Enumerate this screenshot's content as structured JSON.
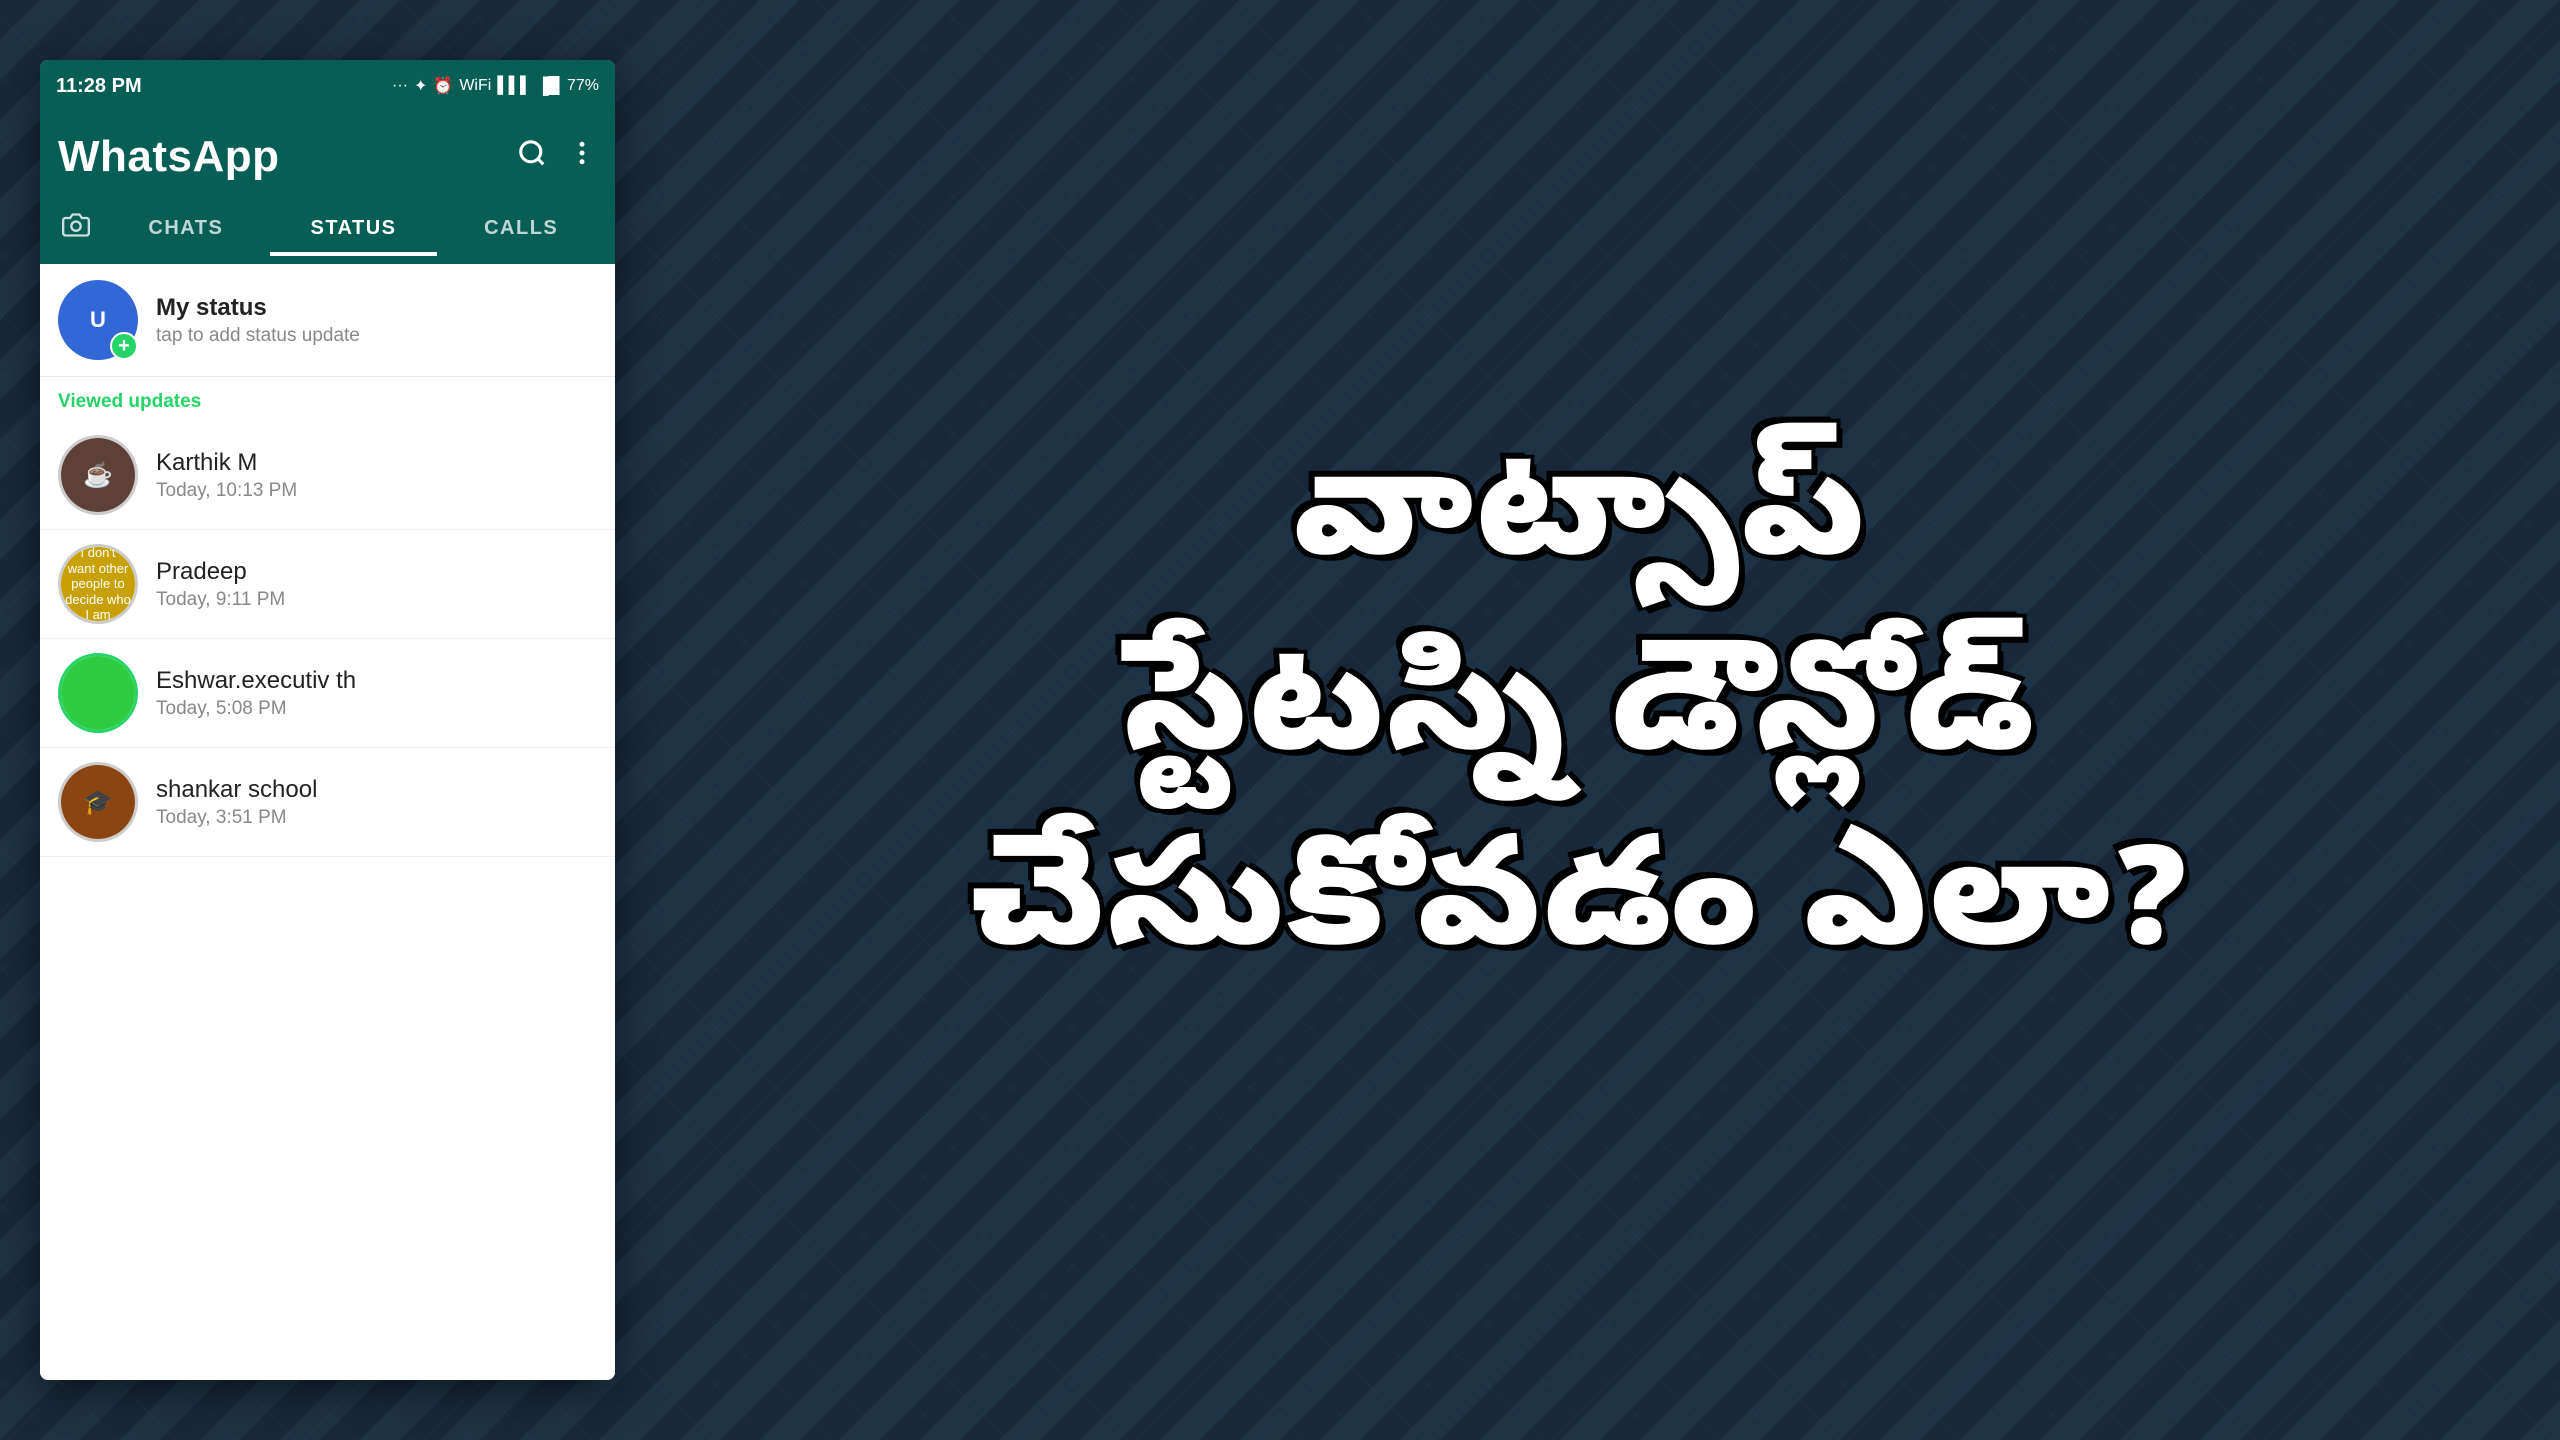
{
  "background": {
    "color": "#1c2d3e"
  },
  "status_bar": {
    "time": "11:28 PM",
    "battery": "77%",
    "icons": "... ⌛ ⏰ ☁ ▌▌▌ 🔋"
  },
  "header": {
    "title": "WhatsApp",
    "search_icon": "search",
    "more_icon": "more-vertical"
  },
  "tabs": [
    {
      "id": "camera",
      "label": "📷",
      "active": false
    },
    {
      "id": "chats",
      "label": "CHATS",
      "active": false
    },
    {
      "id": "status",
      "label": "STATUS",
      "active": true
    },
    {
      "id": "calls",
      "label": "CALLS",
      "active": false
    }
  ],
  "my_status": {
    "title": "My status",
    "subtitle": "tap to add status update",
    "add_icon": "+"
  },
  "viewed_updates_label": "Viewed updates",
  "status_contacts": [
    {
      "name": "Karthik M",
      "time": "Today, 10:13 PM",
      "avatar_color": "#5d4037"
    },
    {
      "name": "Pradeep",
      "time": "Today, 9:11 PM",
      "avatar_color": "#c8a000"
    },
    {
      "name": "Eshwar.executiv th",
      "time": "Today, 5:08 PM",
      "avatar_color": "#2ecc40"
    },
    {
      "name": "shankar school",
      "time": "Today, 3:51 PM",
      "avatar_color": "#8b4513"
    }
  ],
  "telugu_text": "వాట్సాప్\nస్టేటస్ని డౌన్లోడ్\nచేసుకోవడం ఎలా?"
}
